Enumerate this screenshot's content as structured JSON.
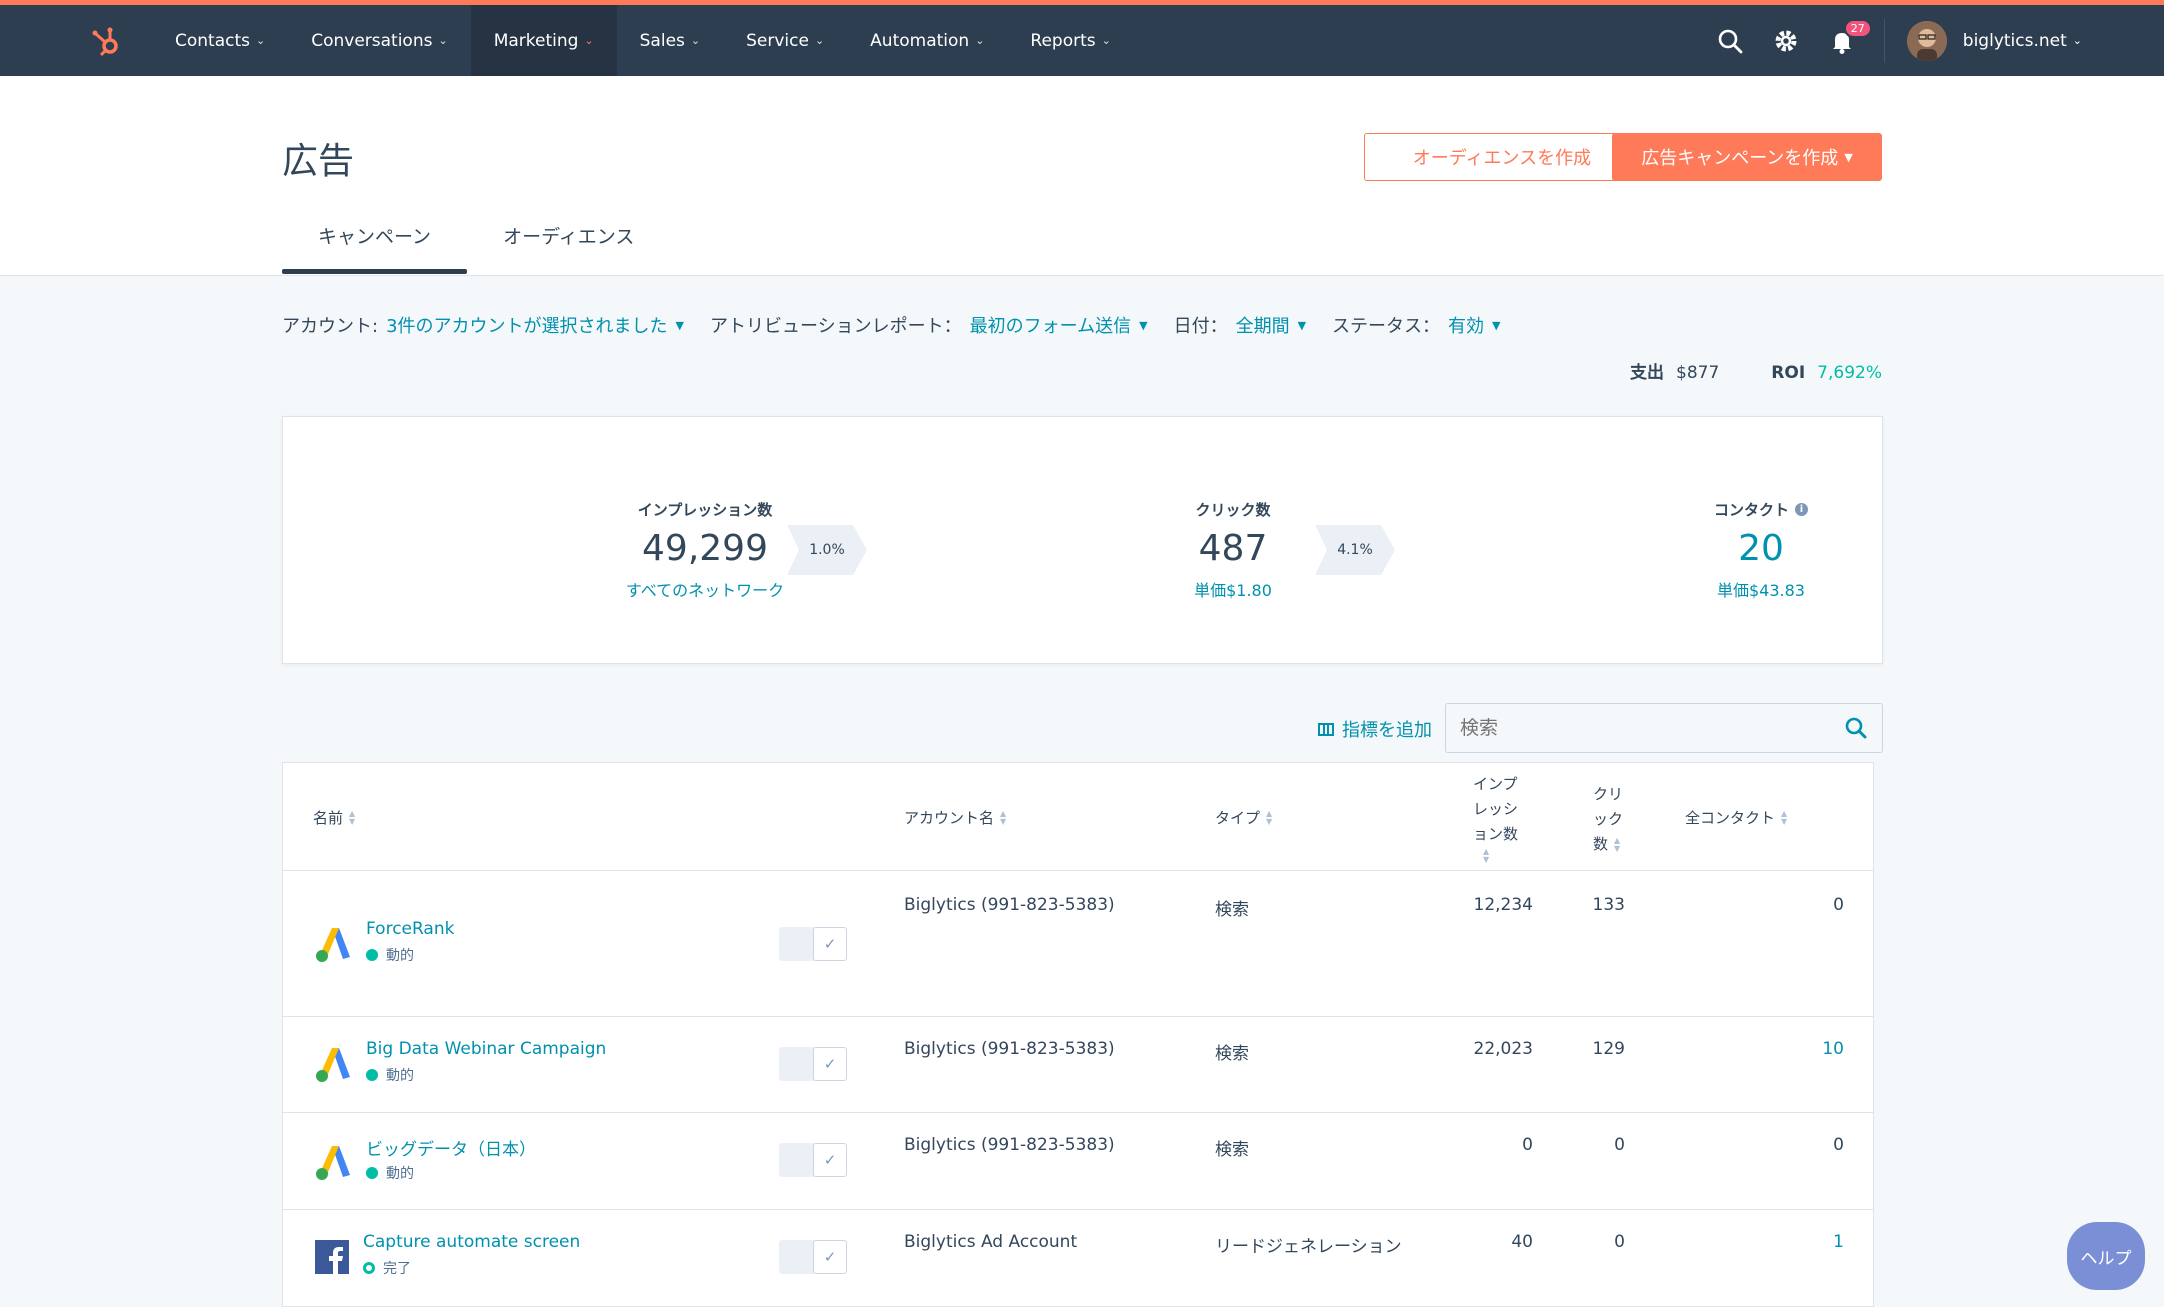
{
  "nav": {
    "items": [
      {
        "label": "Contacts"
      },
      {
        "label": "Conversations"
      },
      {
        "label": "Marketing"
      },
      {
        "label": "Sales"
      },
      {
        "label": "Service"
      },
      {
        "label": "Automation"
      },
      {
        "label": "Reports"
      }
    ],
    "active": "Marketing",
    "notification_count": "27",
    "account": "biglytics.net",
    "icons": [
      "hubspot-logo-icon",
      "search-icon",
      "gear-icon",
      "bell-icon",
      "chevron-down-icon"
    ]
  },
  "page": {
    "title": "広告",
    "create_audience_label": "オーディエンスを作成",
    "create_campaign_label": "広告キャンペーンを作成",
    "tabs": [
      {
        "label": "キャンペーン"
      },
      {
        "label": "オーディエンス"
      }
    ]
  },
  "filters": {
    "account_label": "アカウント:",
    "account_value": "3件のアカウントが選択されました",
    "attribution_label": "アトリビューションレポート：",
    "attribution_value": "最初のフォーム送信",
    "date_label": "日付：",
    "date_value": "全期間",
    "status_label": "ステータス：",
    "status_value": "有効"
  },
  "summary": {
    "spend_label": "支出",
    "spend_value": "$877",
    "roi_label": "ROI",
    "roi_value": "7,692%"
  },
  "stats": {
    "impressions_label": "インプレッション数",
    "impressions_value": "49,299",
    "impressions_sub": "すべてのネットワーク",
    "rate1": "1.0%",
    "clicks_label": "クリック数",
    "clicks_value": "487",
    "clicks_sub": "単価$1.80",
    "rate2": "4.1%",
    "contacts_label": "コンタクト",
    "contacts_value": "20",
    "contacts_sub": "単価$43.83"
  },
  "table_tools": {
    "add_metric_label": "指標を追加",
    "search_placeholder": "検索"
  },
  "table": {
    "headers": {
      "name": "名前",
      "account": "アカウント名",
      "type": "タイプ",
      "impressions_1": "インプ",
      "impressions_2": "レッシ",
      "impressions_3": "ョン数",
      "clicks_1": "クリ",
      "clicks_2": "ック",
      "clicks_3": "数",
      "contacts": "全コンタクト"
    },
    "rows": [
      {
        "name": "ForceRank",
        "status": "動的",
        "account": "Biglytics (991-823-5383)",
        "type": "検索",
        "impressions": "12,234",
        "clicks": "133",
        "contacts": "0",
        "network": "google-ads-icon"
      },
      {
        "name": "Big Data Webinar Campaign",
        "status": "動的",
        "account": "Biglytics (991-823-5383)",
        "type": "検索",
        "impressions": "22,023",
        "clicks": "129",
        "contacts": "10",
        "network": "google-ads-icon"
      },
      {
        "name": "ビッグデータ（日本）",
        "status": "動的",
        "account": "Biglytics (991-823-5383)",
        "type": "検索",
        "impressions": "0",
        "clicks": "0",
        "contacts": "0",
        "network": "google-ads-icon"
      },
      {
        "name": "Capture automate screen",
        "status": "完了",
        "account": "Biglytics Ad Account",
        "type": "リードジェネレーション",
        "impressions": "40",
        "clicks": "0",
        "contacts": "1",
        "network": "facebook-icon"
      }
    ]
  },
  "help_label": "ヘルプ",
  "colors": {
    "topbar": "#2d3e50",
    "accent_orange": "#ff7a59",
    "link_teal": "#0091ae",
    "status_green": "#00bda5"
  }
}
